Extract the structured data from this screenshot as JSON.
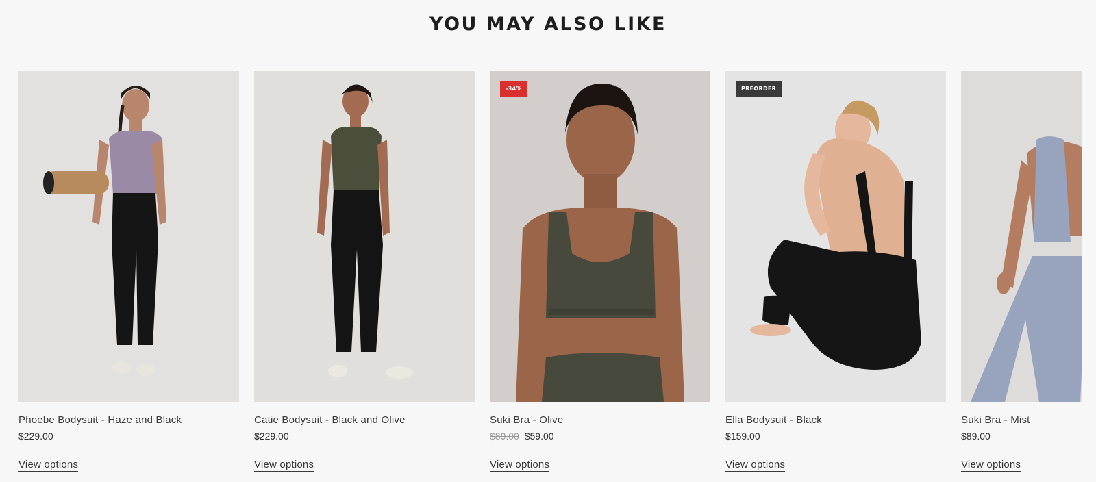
{
  "section": {
    "title": "YOU MAY ALSO LIKE"
  },
  "products": [
    {
      "name": "Phoebe Bodysuit - Haze and Black",
      "price": "$229.00",
      "old_price": "",
      "badge": "",
      "cta": "View options",
      "top_color": "#9a8aa6",
      "bg_color": "#e2e1df"
    },
    {
      "name": "Catie Bodysuit - Black and Olive",
      "price": "$229.00",
      "old_price": "",
      "badge": "",
      "cta": "View options",
      "top_color": "#4b4e3a",
      "bg_color": "#e1dfdc"
    },
    {
      "name": "Suki Bra - Olive",
      "price": "$59.00",
      "old_price": "$89.00",
      "badge": "-34%",
      "cta": "View options",
      "top_color": "#46493b",
      "bg_color": "#d3cecb"
    },
    {
      "name": "Ella Bodysuit - Black",
      "price": "$159.00",
      "old_price": "",
      "badge": "PREORDER",
      "cta": "View options",
      "top_color": "#18181a",
      "bg_color": "#e4e4e4"
    },
    {
      "name": "Suki Bra - Mist",
      "price": "$89.00",
      "old_price": "",
      "badge": "",
      "cta": "View options",
      "top_color": "#98a4be",
      "bg_color": "#dedcda"
    }
  ]
}
